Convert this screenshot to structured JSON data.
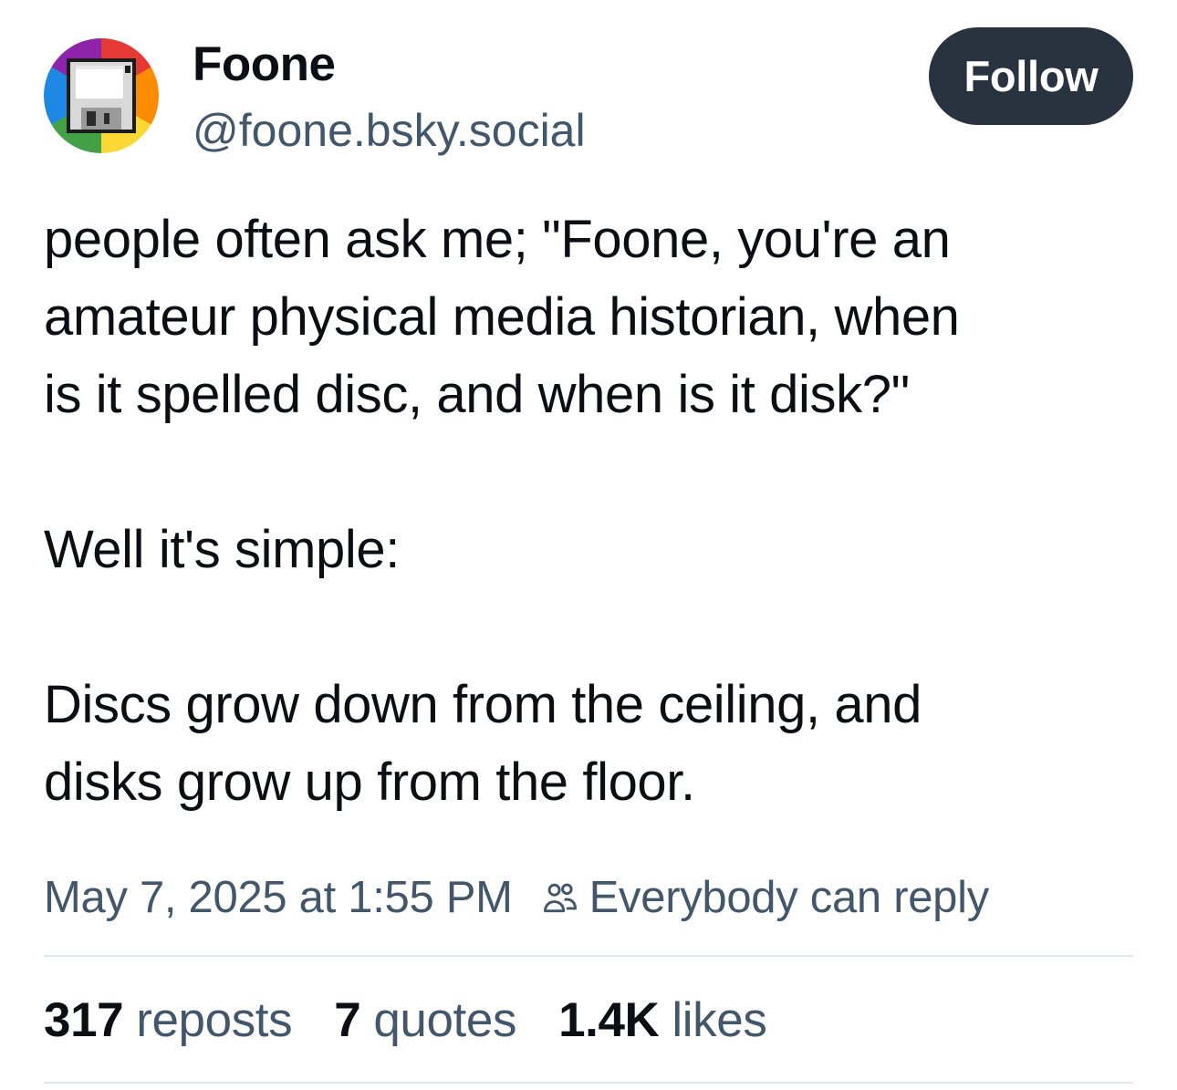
{
  "author": {
    "display_name": "Foone",
    "handle": "@foone.bsky.social",
    "avatar_icon": "floppy-disk-icon",
    "avatar_ring_colors": [
      "#e53935",
      "#fb8c00",
      "#fdd835",
      "#43a047",
      "#1e88e5",
      "#8e24aa"
    ]
  },
  "follow_button": {
    "label": "Follow",
    "background": "#29333f"
  },
  "post": {
    "paragraphs": [
      {
        "lines": [
          "people often ask me; \"Foone, you're an",
          "amateur physical media historian, when",
          "is it spelled disc, and when is it disk?\""
        ]
      },
      {
        "lines": [
          "Well it's simple:"
        ]
      },
      {
        "lines": [
          "Discs grow down from the ceiling, and",
          "disks grow up from the floor."
        ]
      }
    ]
  },
  "meta": {
    "timestamp": "May 7, 2025 at 1:55 PM",
    "reply_icon": "people-icon",
    "reply_setting": "Everybody can reply"
  },
  "stats": {
    "reposts_count": "317",
    "reposts_label": "reposts",
    "quotes_count": "7",
    "quotes_label": "quotes",
    "likes_count": "1.4K",
    "likes_label": "likes"
  },
  "colors": {
    "text_primary": "#0b0f14",
    "text_secondary": "#42576c",
    "divider": "#e3e8ee"
  }
}
